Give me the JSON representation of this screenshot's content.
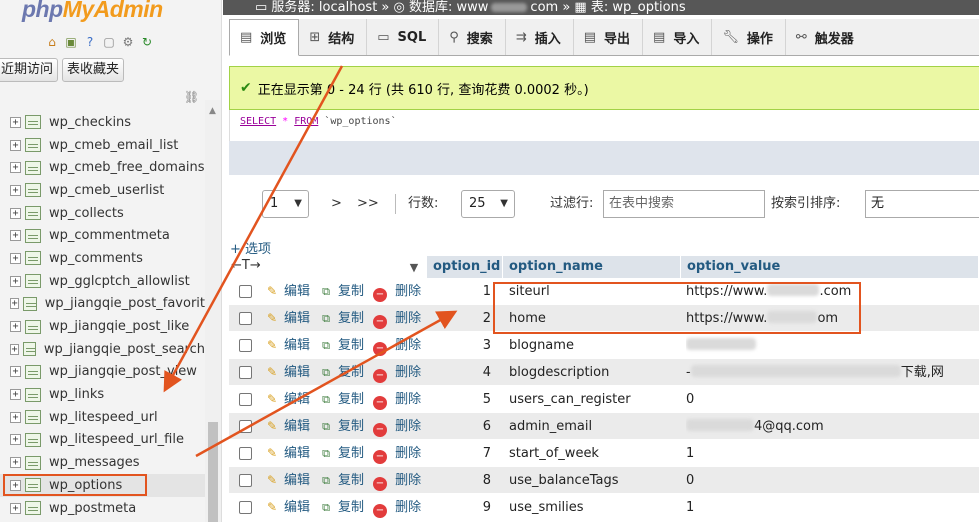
{
  "sidebar": {
    "logo_php": "php",
    "logo_myadmin": "MyAdmin",
    "nav_icons": [
      "home-icon",
      "exit-icon",
      "help-icon",
      "docs-icon",
      "settings-icon",
      "reload-icon"
    ],
    "tab_recent": "近期访问",
    "tab_favorites": "表收藏夹",
    "tables": [
      "wp_checkins",
      "wp_cmeb_email_list",
      "wp_cmeb_free_domains",
      "wp_cmeb_userlist",
      "wp_collects",
      "wp_commentmeta",
      "wp_comments",
      "wp_gglcptch_allowlist",
      "wp_jiangqie_post_favorit",
      "wp_jiangqie_post_like",
      "wp_jiangqie_post_search",
      "wp_jiangqie_post_view",
      "wp_links",
      "wp_litespeed_url",
      "wp_litespeed_url_file",
      "wp_messages",
      "wp_options",
      "wp_postmeta"
    ],
    "active_table": "wp_options"
  },
  "breadcrumb": {
    "server": "服务器: localhost »",
    "database": "数据库: www",
    "database_suffix": "com »",
    "table": "表: wp_options"
  },
  "tabs": [
    {
      "label": "浏览",
      "icon": "browse-icon"
    },
    {
      "label": "结构",
      "icon": "structure-icon"
    },
    {
      "label": "SQL",
      "icon": "sql-icon"
    },
    {
      "label": "搜索",
      "icon": "search-icon"
    },
    {
      "label": "插入",
      "icon": "insert-icon"
    },
    {
      "label": "导出",
      "icon": "export-icon"
    },
    {
      "label": "导入",
      "icon": "import-icon"
    },
    {
      "label": "操作",
      "icon": "wrench-icon"
    },
    {
      "label": "触发器",
      "icon": "trigger-icon"
    }
  ],
  "message": {
    "text": "正在显示第 0 - 24 行 (共 610 行, 查询花费 0.0002 秒。)"
  },
  "sql": {
    "select": "SELECT",
    "star": "*",
    "from": "FROM",
    "table": "`wp_options`"
  },
  "pager": {
    "page": "1",
    "next": ">",
    "last": ">>",
    "rows_label": "行数:",
    "rows_value": "25",
    "filter_label": "过滤行:",
    "filter_placeholder": "在表中搜索",
    "sort_label": "按索引排序:",
    "sort_value": "无"
  },
  "options_link": "+ 选项",
  "header_arrows": "←T→",
  "columns": [
    "option_id",
    "option_name",
    "option_value"
  ],
  "actions": {
    "edit": "编辑",
    "copy": "复制",
    "delete": "删除"
  },
  "rows": [
    {
      "id": "1",
      "name": "siteurl",
      "value_prefix": "https://www.",
      "value_suffix": ".com"
    },
    {
      "id": "2",
      "name": "home",
      "value_prefix": "https://www.",
      "value_suffix": "om"
    },
    {
      "id": "3",
      "name": "blogname",
      "value_prefix": "",
      "value_suffix": ""
    },
    {
      "id": "4",
      "name": "blogdescription",
      "value_prefix": "-",
      "value_suffix": "下载,网"
    },
    {
      "id": "5",
      "name": "users_can_register",
      "value_prefix": "0",
      "value_suffix": ""
    },
    {
      "id": "6",
      "name": "admin_email",
      "value_prefix": "",
      "value_suffix": "4@qq.com"
    },
    {
      "id": "7",
      "name": "start_of_week",
      "value_prefix": "1",
      "value_suffix": ""
    },
    {
      "id": "8",
      "name": "use_balanceTags",
      "value_prefix": "0",
      "value_suffix": ""
    },
    {
      "id": "9",
      "name": "use_smilies",
      "value_prefix": "1",
      "value_suffix": ""
    }
  ],
  "colors": {
    "highlight": "#e2541f",
    "success_bg": "#ebf8a4",
    "link": "#235a81"
  }
}
